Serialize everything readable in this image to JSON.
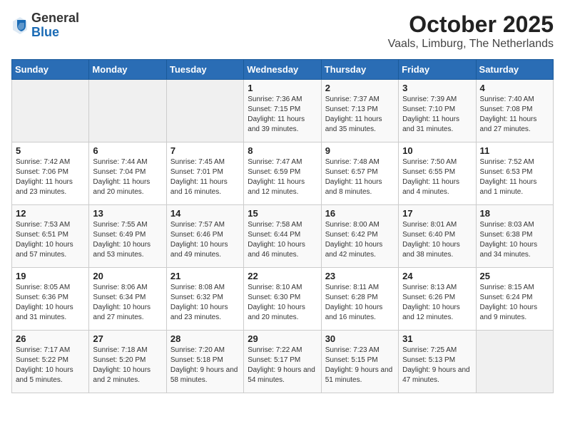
{
  "header": {
    "logo_general": "General",
    "logo_blue": "Blue",
    "month": "October 2025",
    "location": "Vaals, Limburg, The Netherlands"
  },
  "calendar": {
    "days_of_week": [
      "Sunday",
      "Monday",
      "Tuesday",
      "Wednesday",
      "Thursday",
      "Friday",
      "Saturday"
    ],
    "weeks": [
      {
        "days": [
          {
            "num": "",
            "info": ""
          },
          {
            "num": "",
            "info": ""
          },
          {
            "num": "",
            "info": ""
          },
          {
            "num": "1",
            "info": "Sunrise: 7:36 AM\nSunset: 7:15 PM\nDaylight: 11 hours and 39 minutes."
          },
          {
            "num": "2",
            "info": "Sunrise: 7:37 AM\nSunset: 7:13 PM\nDaylight: 11 hours and 35 minutes."
          },
          {
            "num": "3",
            "info": "Sunrise: 7:39 AM\nSunset: 7:10 PM\nDaylight: 11 hours and 31 minutes."
          },
          {
            "num": "4",
            "info": "Sunrise: 7:40 AM\nSunset: 7:08 PM\nDaylight: 11 hours and 27 minutes."
          }
        ]
      },
      {
        "days": [
          {
            "num": "5",
            "info": "Sunrise: 7:42 AM\nSunset: 7:06 PM\nDaylight: 11 hours and 23 minutes."
          },
          {
            "num": "6",
            "info": "Sunrise: 7:44 AM\nSunset: 7:04 PM\nDaylight: 11 hours and 20 minutes."
          },
          {
            "num": "7",
            "info": "Sunrise: 7:45 AM\nSunset: 7:01 PM\nDaylight: 11 hours and 16 minutes."
          },
          {
            "num": "8",
            "info": "Sunrise: 7:47 AM\nSunset: 6:59 PM\nDaylight: 11 hours and 12 minutes."
          },
          {
            "num": "9",
            "info": "Sunrise: 7:48 AM\nSunset: 6:57 PM\nDaylight: 11 hours and 8 minutes."
          },
          {
            "num": "10",
            "info": "Sunrise: 7:50 AM\nSunset: 6:55 PM\nDaylight: 11 hours and 4 minutes."
          },
          {
            "num": "11",
            "info": "Sunrise: 7:52 AM\nSunset: 6:53 PM\nDaylight: 11 hours and 1 minute."
          }
        ]
      },
      {
        "days": [
          {
            "num": "12",
            "info": "Sunrise: 7:53 AM\nSunset: 6:51 PM\nDaylight: 10 hours and 57 minutes."
          },
          {
            "num": "13",
            "info": "Sunrise: 7:55 AM\nSunset: 6:49 PM\nDaylight: 10 hours and 53 minutes."
          },
          {
            "num": "14",
            "info": "Sunrise: 7:57 AM\nSunset: 6:46 PM\nDaylight: 10 hours and 49 minutes."
          },
          {
            "num": "15",
            "info": "Sunrise: 7:58 AM\nSunset: 6:44 PM\nDaylight: 10 hours and 46 minutes."
          },
          {
            "num": "16",
            "info": "Sunrise: 8:00 AM\nSunset: 6:42 PM\nDaylight: 10 hours and 42 minutes."
          },
          {
            "num": "17",
            "info": "Sunrise: 8:01 AM\nSunset: 6:40 PM\nDaylight: 10 hours and 38 minutes."
          },
          {
            "num": "18",
            "info": "Sunrise: 8:03 AM\nSunset: 6:38 PM\nDaylight: 10 hours and 34 minutes."
          }
        ]
      },
      {
        "days": [
          {
            "num": "19",
            "info": "Sunrise: 8:05 AM\nSunset: 6:36 PM\nDaylight: 10 hours and 31 minutes."
          },
          {
            "num": "20",
            "info": "Sunrise: 8:06 AM\nSunset: 6:34 PM\nDaylight: 10 hours and 27 minutes."
          },
          {
            "num": "21",
            "info": "Sunrise: 8:08 AM\nSunset: 6:32 PM\nDaylight: 10 hours and 23 minutes."
          },
          {
            "num": "22",
            "info": "Sunrise: 8:10 AM\nSunset: 6:30 PM\nDaylight: 10 hours and 20 minutes."
          },
          {
            "num": "23",
            "info": "Sunrise: 8:11 AM\nSunset: 6:28 PM\nDaylight: 10 hours and 16 minutes."
          },
          {
            "num": "24",
            "info": "Sunrise: 8:13 AM\nSunset: 6:26 PM\nDaylight: 10 hours and 12 minutes."
          },
          {
            "num": "25",
            "info": "Sunrise: 8:15 AM\nSunset: 6:24 PM\nDaylight: 10 hours and 9 minutes."
          }
        ]
      },
      {
        "days": [
          {
            "num": "26",
            "info": "Sunrise: 7:17 AM\nSunset: 5:22 PM\nDaylight: 10 hours and 5 minutes."
          },
          {
            "num": "27",
            "info": "Sunrise: 7:18 AM\nSunset: 5:20 PM\nDaylight: 10 hours and 2 minutes."
          },
          {
            "num": "28",
            "info": "Sunrise: 7:20 AM\nSunset: 5:18 PM\nDaylight: 9 hours and 58 minutes."
          },
          {
            "num": "29",
            "info": "Sunrise: 7:22 AM\nSunset: 5:17 PM\nDaylight: 9 hours and 54 minutes."
          },
          {
            "num": "30",
            "info": "Sunrise: 7:23 AM\nSunset: 5:15 PM\nDaylight: 9 hours and 51 minutes."
          },
          {
            "num": "31",
            "info": "Sunrise: 7:25 AM\nSunset: 5:13 PM\nDaylight: 9 hours and 47 minutes."
          },
          {
            "num": "",
            "info": ""
          }
        ]
      }
    ]
  }
}
